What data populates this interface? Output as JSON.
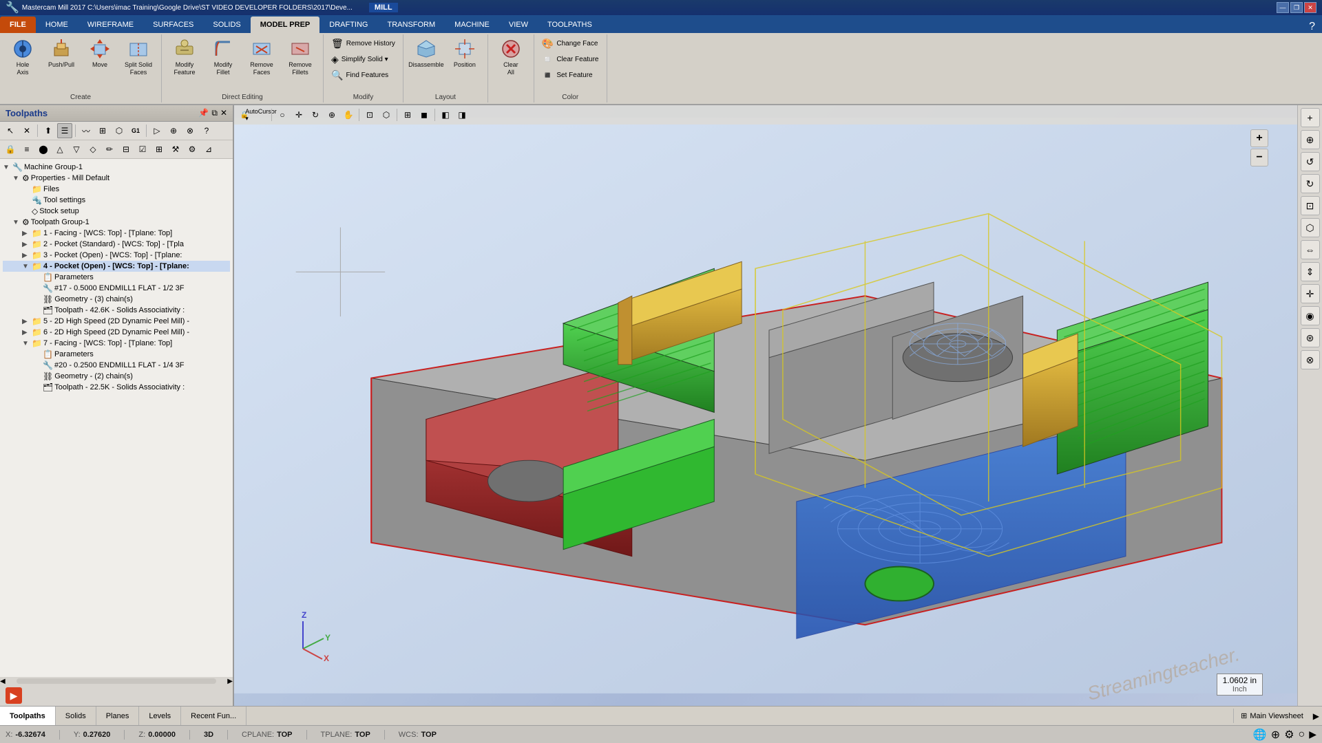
{
  "titlebar": {
    "title": "Mastercam Mill 2017  C:\\Users\\imac Training\\Google Drive\\ST VIDEO DEVELOPER FOLDERS\\2017\\Deve...",
    "mill_label": "MILL",
    "minimize": "—",
    "restore": "❐",
    "close": "✕"
  },
  "ribbon": {
    "tabs": [
      {
        "label": "FILE",
        "type": "file",
        "active": false
      },
      {
        "label": "HOME",
        "type": "normal",
        "active": false
      },
      {
        "label": "WIREFRAME",
        "type": "normal",
        "active": false
      },
      {
        "label": "SURFACES",
        "type": "normal",
        "active": false
      },
      {
        "label": "SOLIDS",
        "type": "normal",
        "active": false
      },
      {
        "label": "MODEL PREP",
        "type": "normal",
        "active": true
      },
      {
        "label": "DRAFTING",
        "type": "normal",
        "active": false
      },
      {
        "label": "TRANSFORM",
        "type": "normal",
        "active": false
      },
      {
        "label": "MACHINE",
        "type": "normal",
        "active": false
      },
      {
        "label": "VIEW",
        "type": "normal",
        "active": false
      },
      {
        "label": "TOOLPATHS",
        "type": "normal",
        "active": false
      }
    ],
    "groups": {
      "create": {
        "label": "Create",
        "items": [
          {
            "label": "Hole\nAxis",
            "icon": "⊕"
          },
          {
            "label": "Push/Pull",
            "icon": "⬆"
          },
          {
            "label": "Move",
            "icon": "↔"
          },
          {
            "label": "Split Solid\nFaces",
            "icon": "⬜"
          }
        ]
      },
      "direct_editing": {
        "label": "Direct Editing",
        "items": [
          {
            "label": "Modify\nFeature",
            "icon": "⚙"
          },
          {
            "label": "Modify\nFillet",
            "icon": "◔"
          },
          {
            "label": "Remove\nFaces",
            "icon": "✂"
          },
          {
            "label": "Remove\nFillets",
            "icon": "✂"
          }
        ]
      },
      "modify": {
        "label": "Modify",
        "small_items": [
          {
            "label": "Remove History",
            "icon": "🗑"
          },
          {
            "label": "Simplify Solid",
            "icon": "◈",
            "has_arrow": true
          },
          {
            "label": "Find Features",
            "icon": "🔍"
          }
        ]
      },
      "layout": {
        "label": "Layout",
        "items": [
          {
            "label": "Disassemble",
            "icon": "⬡"
          },
          {
            "label": "Position",
            "icon": "📐"
          }
        ]
      },
      "layout2": {
        "label": "",
        "items": [
          {
            "label": "Clear\nAll",
            "icon": "✖"
          }
        ]
      },
      "color": {
        "label": "Color",
        "small_items": [
          {
            "label": "Change Face",
            "icon": "🎨"
          },
          {
            "label": "Clear Feature",
            "icon": "◽"
          },
          {
            "label": "Set Feature",
            "icon": "◾"
          }
        ]
      }
    }
  },
  "panel": {
    "title": "Toolpaths",
    "tree": [
      {
        "level": 0,
        "label": "Machine Group-1",
        "icon": "🔧",
        "expanded": true,
        "type": "group"
      },
      {
        "level": 1,
        "label": "Properties - Mill Default",
        "icon": "⚙",
        "expanded": true,
        "type": "props"
      },
      {
        "level": 2,
        "label": "Files",
        "icon": "📁",
        "expanded": false,
        "type": "files"
      },
      {
        "level": 2,
        "label": "Tool settings",
        "icon": "🔩",
        "expanded": false,
        "type": "settings"
      },
      {
        "level": 2,
        "label": "Stock setup",
        "icon": "◇",
        "expanded": false,
        "type": "stock"
      },
      {
        "level": 1,
        "label": "Toolpath Group-1",
        "icon": "⚙",
        "expanded": true,
        "type": "tgroup"
      },
      {
        "level": 2,
        "label": "1 - Facing - [WCS: Top] - [Tplane: Top]",
        "icon": "📁",
        "type": "op"
      },
      {
        "level": 2,
        "label": "2 - Pocket (Standard) - [WCS: Top] - [Tpla",
        "icon": "📁",
        "type": "op"
      },
      {
        "level": 2,
        "label": "3 - Pocket (Open) - [WCS: Top] - [Tplane:",
        "icon": "📁",
        "type": "op"
      },
      {
        "level": 2,
        "label": "4 - Pocket (Open) - [WCS: Top] - [Tplane:",
        "icon": "📁",
        "expanded": true,
        "type": "op",
        "active": true
      },
      {
        "level": 3,
        "label": "Parameters",
        "icon": "📋",
        "type": "params"
      },
      {
        "level": 3,
        "label": "#17 - 0.5000 ENDMILL1 FLAT - 1/2 3F",
        "icon": "🔧",
        "type": "tool"
      },
      {
        "level": 3,
        "label": "Geometry - (3) chain(s)",
        "icon": "⛓",
        "type": "geo"
      },
      {
        "level": 3,
        "label": "Toolpath - 42.6K - Solids Associativity :",
        "icon": "🗂",
        "type": "tp"
      },
      {
        "level": 2,
        "label": "5 - 2D High Speed (2D Dynamic Peel Mill) -",
        "icon": "📁",
        "type": "op"
      },
      {
        "level": 2,
        "label": "6 - 2D High Speed (2D Dynamic Peel Mill) -",
        "icon": "📁",
        "type": "op"
      },
      {
        "level": 2,
        "label": "7 - Facing - [WCS: Top] - [Tplane: Top]",
        "icon": "📁",
        "expanded": true,
        "type": "op"
      },
      {
        "level": 3,
        "label": "Parameters",
        "icon": "📋",
        "type": "params"
      },
      {
        "level": 3,
        "label": "#20 - 0.2500 ENDMILL1 FLAT - 1/4 3F",
        "icon": "🔧",
        "type": "tool"
      },
      {
        "level": 3,
        "label": "Geometry - (2) chain(s)",
        "icon": "⛓",
        "type": "geo"
      },
      {
        "level": 3,
        "label": "Toolpath - 22.5K - Solids Associativity :",
        "icon": "🗂",
        "type": "tp"
      }
    ],
    "play_btn": "▶"
  },
  "bottom_tabs": {
    "tabs": [
      "Toolpaths",
      "Solids",
      "Planes",
      "Levels",
      "Recent Fun..."
    ],
    "active": "Toolpaths",
    "viewsheet": "Main Viewsheet"
  },
  "statusbar": {
    "x_label": "X:",
    "x_value": "-6.32674",
    "y_label": "Y:",
    "y_value": "0.27620",
    "z_label": "Z:",
    "z_value": "0.00000",
    "dim": "3D",
    "cplane_label": "CPLANE:",
    "cplane_value": "TOP",
    "tplane_label": "TPLANE:",
    "tplane_value": "TOP",
    "wcs_label": "WCS:",
    "wcs_value": "TOP"
  },
  "viewport": {
    "scale_value": "1.0602 in",
    "scale_unit": "Inch",
    "watermark": "Streamingteacher.",
    "axis": {
      "z": "Z",
      "y": "Y",
      "x": "X"
    }
  },
  "icons": {
    "plus": "+",
    "gear": "⚙",
    "search": "🔍",
    "paint": "🎨",
    "clear": "✖",
    "minus": "−",
    "lock": "🔒",
    "layers": "≡",
    "globe": "🌐",
    "arrow_down": "▼",
    "arrow_up": "▲",
    "arrow_right": "▶",
    "arrow_left": "◀",
    "rotate_cw": "↻",
    "rotate_ccw": "↺",
    "fit": "⊡",
    "zoom_in": "+",
    "zoom_out": "−"
  }
}
